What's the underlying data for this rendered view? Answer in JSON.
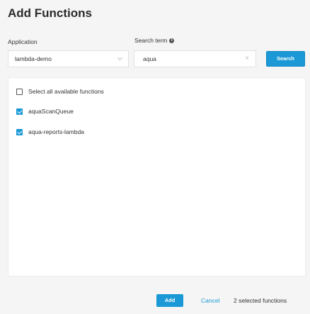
{
  "dialog": {
    "title": "Add Functions"
  },
  "form": {
    "application_label": "Application",
    "application_value": "lambda-demo",
    "search_label": "Search term",
    "search_value": "aqua",
    "search_button": "Search"
  },
  "list": {
    "select_all_label": "Select all available functions",
    "select_all_checked": false,
    "items": [
      {
        "label": "aquaScanQueue",
        "checked": true
      },
      {
        "label": "aqua-reports-lambda",
        "checked": true
      }
    ]
  },
  "footer": {
    "add_label": "Add",
    "cancel_label": "Cancel",
    "selected_text": "2 selected functions"
  },
  "colors": {
    "accent": "#1a99d6",
    "background": "#f5f5f5"
  },
  "icons": {
    "info": "info-icon",
    "clear": "close-icon",
    "dropdown": "chevron-down-icon"
  }
}
